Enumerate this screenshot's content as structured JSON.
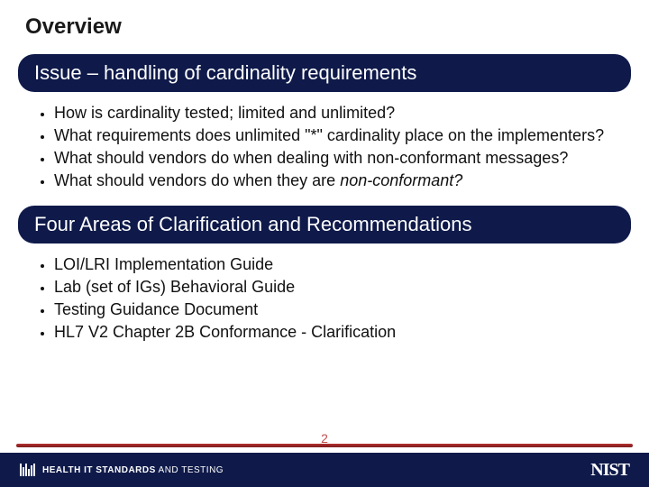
{
  "title": "Overview",
  "section1": {
    "heading": "Issue – handling of cardinality requirements",
    "bullets": [
      "How is cardinality tested; limited and unlimited?",
      "What requirements does unlimited \"*\" cardinality  place on the implementers?",
      "What should vendors do when dealing with non-conformant messages?",
      "What should vendors do when they are "
    ],
    "bullet3_suffix": "non-conformant?"
  },
  "section2": {
    "heading": "Four Areas of Clarification and Recommendations",
    "bullets": [
      "LOI/LRI Implementation Guide",
      "Lab (set of IGs) Behavioral Guide",
      "Testing Guidance Document",
      "HL7 V2 Chapter 2B Conformance - Clarification"
    ]
  },
  "footer": {
    "left_strong": "HEALTH IT STANDARDS",
    "left_rest": " AND TESTING",
    "right": "NIST"
  },
  "page_number": "2"
}
